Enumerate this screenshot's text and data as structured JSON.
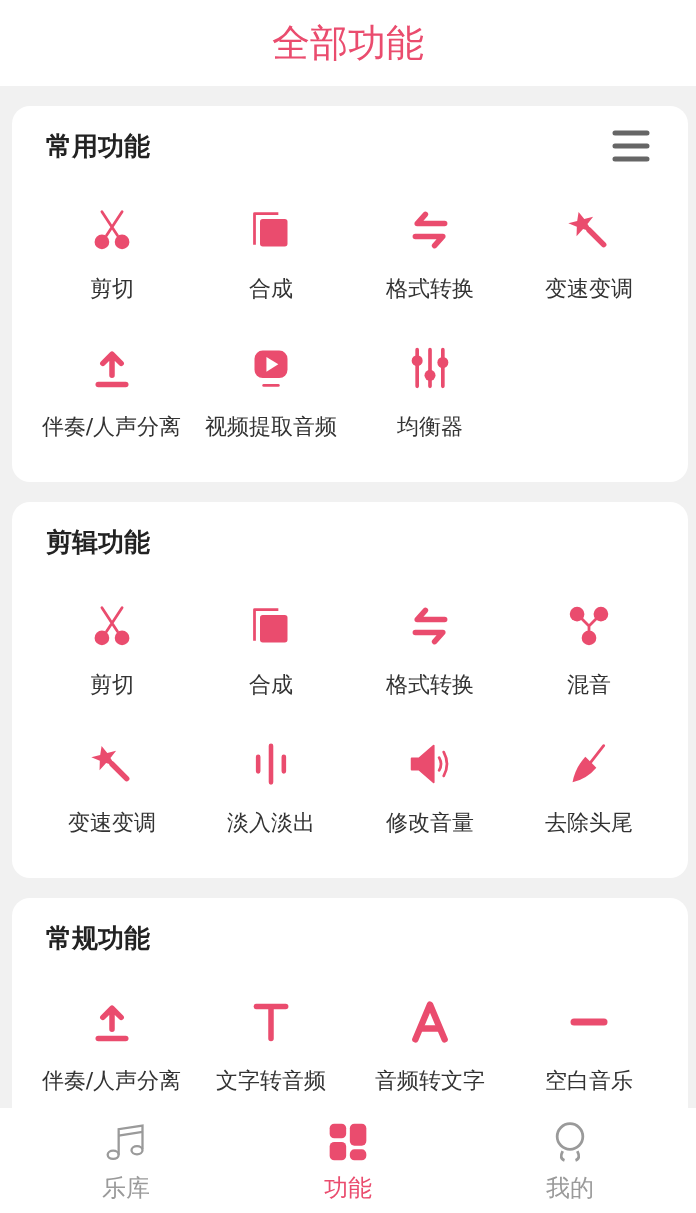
{
  "header": {
    "title": "全部功能"
  },
  "sections": [
    {
      "title": "常用功能",
      "has_menu": true,
      "items": [
        {
          "label": "剪切",
          "kind": "cut"
        },
        {
          "label": "合成",
          "kind": "merge"
        },
        {
          "label": "格式转换",
          "kind": "convert"
        },
        {
          "label": "变速变调",
          "kind": "wand"
        },
        {
          "label": "伴奏/人声分离",
          "kind": "upload"
        },
        {
          "label": "视频提取音频",
          "kind": "video"
        },
        {
          "label": "均衡器",
          "kind": "equalizer"
        }
      ]
    },
    {
      "title": "剪辑功能",
      "has_menu": false,
      "items": [
        {
          "label": "剪切",
          "kind": "cut"
        },
        {
          "label": "合成",
          "kind": "merge"
        },
        {
          "label": "格式转换",
          "kind": "convert"
        },
        {
          "label": "混音",
          "kind": "mix"
        },
        {
          "label": "变速变调",
          "kind": "wand"
        },
        {
          "label": "淡入淡出",
          "kind": "bars"
        },
        {
          "label": "修改音量",
          "kind": "volume"
        },
        {
          "label": "去除头尾",
          "kind": "trowel"
        }
      ]
    },
    {
      "title": "常规功能",
      "has_menu": false,
      "items": [
        {
          "label": "伴奏/人声分离",
          "kind": "upload"
        },
        {
          "label": "文字转音频",
          "kind": "text"
        },
        {
          "label": "音频转文字",
          "kind": "letter"
        },
        {
          "label": "空白音乐",
          "kind": "dash"
        }
      ]
    }
  ],
  "nav": [
    {
      "label": "乐库",
      "kind": "music",
      "selected": false
    },
    {
      "label": "功能",
      "kind": "grid",
      "selected": true
    },
    {
      "label": "我的",
      "kind": "person",
      "selected": false
    }
  ]
}
